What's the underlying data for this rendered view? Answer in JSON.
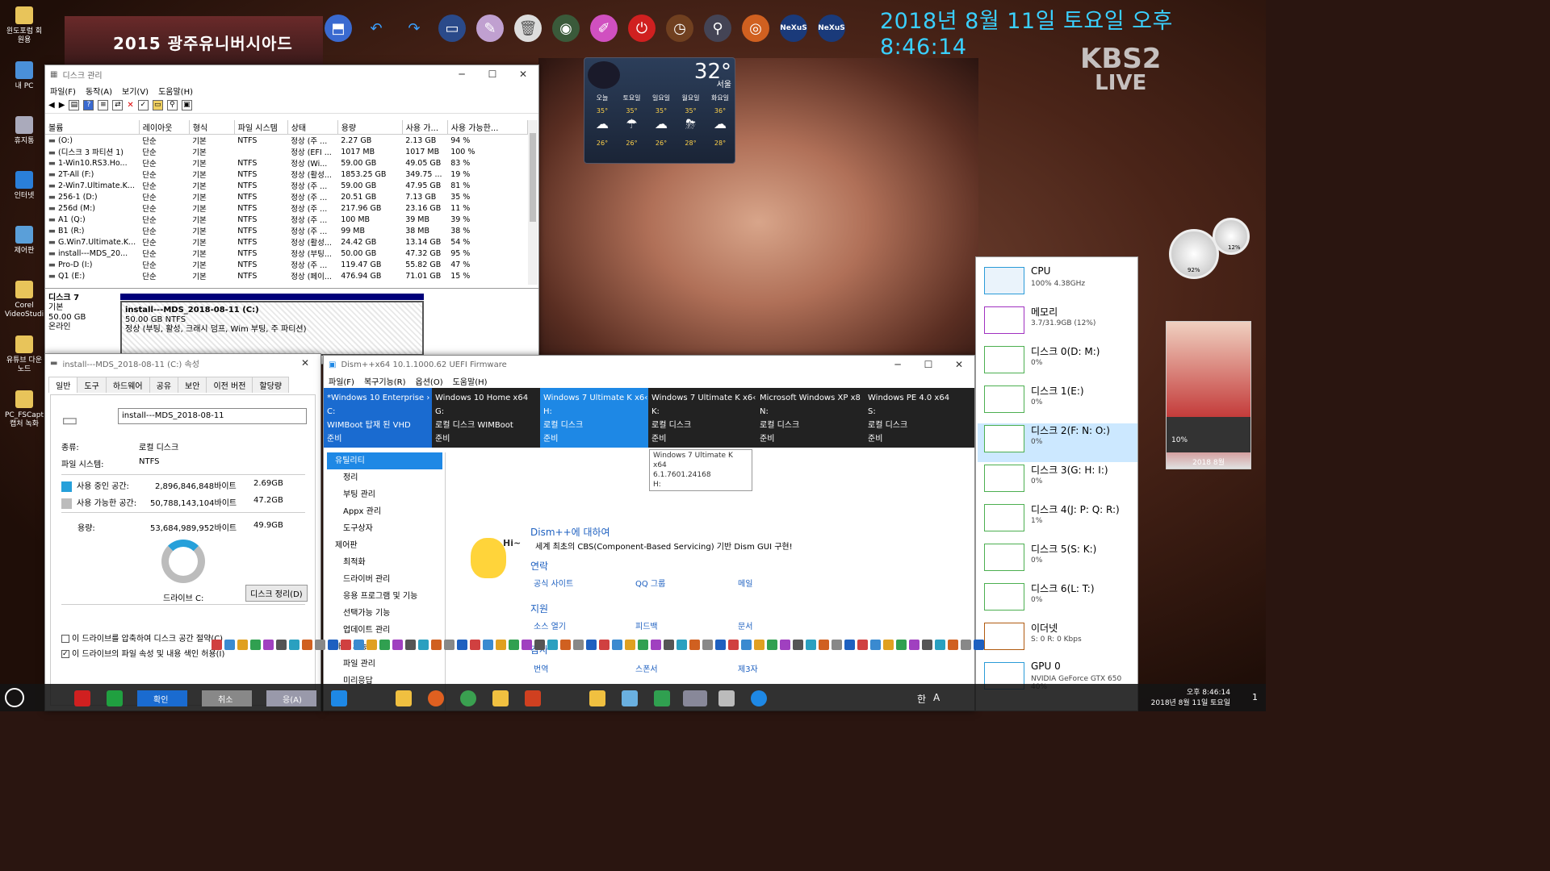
{
  "desktop": {
    "clock": "2018년 8월 11일 토요일 오후 8:46:14",
    "banner": "2015 광주유니버시아드",
    "channel": "KBS2",
    "channel_sub": "LIVE",
    "icons": [
      {
        "label": "윈도포럼 회원용",
        "color": "#e8c45a"
      },
      {
        "label": "내 PC",
        "color": "#4a90d9"
      },
      {
        "label": "휴지통",
        "color": "#aab"
      },
      {
        "label": "인터넷",
        "color": "#2a7fd9"
      },
      {
        "label": "제어판",
        "color": "#5a9fd9"
      },
      {
        "label": "Corel VideoStudi",
        "color": "#e8c45a"
      },
      {
        "label": "유튜브 다운노드",
        "color": "#e8c45a"
      },
      {
        "label": "PC_FSCapt 캡처 녹화",
        "color": "#e8c45a"
      }
    ],
    "toolbar_icons": [
      "usb-icon",
      "undo-icon",
      "redo-icon",
      "monitor-icon",
      "brush-icon",
      "trash-icon",
      "network-icon",
      "eraser-icon",
      "power-icon",
      "clock-icon",
      "search-icon",
      "media-icon",
      "nexus-icon",
      "nexus-icon"
    ],
    "toolbar_text": {
      "nexus1": "NeXuS",
      "nexus2": "NeXuS"
    }
  },
  "weather": {
    "temp": "32°",
    "city": "서울",
    "days": [
      {
        "name": "오늘",
        "hi": "35°",
        "lo": "26°",
        "icon": "☁"
      },
      {
        "name": "토요일",
        "hi": "35°",
        "lo": "26°",
        "icon": "☂"
      },
      {
        "name": "일요일",
        "hi": "35°",
        "lo": "26°",
        "icon": "☁"
      },
      {
        "name": "월요일",
        "hi": "35°",
        "lo": "28°",
        "icon": "⛈"
      },
      {
        "name": "화요일",
        "hi": "36°",
        "lo": "28°",
        "icon": "☁"
      }
    ]
  },
  "diskmgmt": {
    "title": "디스크 관리",
    "menu": [
      "파일(F)",
      "동작(A)",
      "보기(V)",
      "도움말(H)"
    ],
    "columns": [
      "볼륨",
      "레이아웃",
      "형식",
      "파일 시스템",
      "상태",
      "용량",
      "사용 가...",
      "사용 가능한..."
    ],
    "rows": [
      [
        "(O:)",
        "단순",
        "기본",
        "NTFS",
        "정상 (주 ...",
        "2.27 GB",
        "2.13 GB",
        "94 %"
      ],
      [
        "(디스크 3 파티션 1)",
        "단순",
        "기본",
        "",
        "정상 (EFI ...",
        "1017 MB",
        "1017 MB",
        "100 %"
      ],
      [
        "1-Win10.RS3.Ho...",
        "단순",
        "기본",
        "NTFS",
        "정상 (Wi...",
        "59.00 GB",
        "49.05 GB",
        "83 %"
      ],
      [
        "2T-All (F:)",
        "단순",
        "기본",
        "NTFS",
        "정상 (활성...",
        "1853.25 GB",
        "349.75 ...",
        "19 %"
      ],
      [
        "2-Win7.Ultimate.K...",
        "단순",
        "기본",
        "NTFS",
        "정상 (주 ...",
        "59.00 GB",
        "47.95 GB",
        "81 %"
      ],
      [
        "256-1 (D:)",
        "단순",
        "기본",
        "NTFS",
        "정상 (주 ...",
        "20.51 GB",
        "7.13 GB",
        "35 %"
      ],
      [
        "256d (M:)",
        "단순",
        "기본",
        "NTFS",
        "정상 (주 ...",
        "217.96 GB",
        "23.16 GB",
        "11 %"
      ],
      [
        "A1 (Q:)",
        "단순",
        "기본",
        "NTFS",
        "정상 (주 ...",
        "100 MB",
        "39 MB",
        "39 %"
      ],
      [
        "B1 (R:)",
        "단순",
        "기본",
        "NTFS",
        "정상 (주 ...",
        "99 MB",
        "38 MB",
        "38 %"
      ],
      [
        "G.Win7.Ultimate.K...",
        "단순",
        "기본",
        "NTFS",
        "정상 (활성...",
        "24.42 GB",
        "13.14 GB",
        "54 %"
      ],
      [
        "install---MDS_20...",
        "단순",
        "기본",
        "NTFS",
        "정상 (부팅...",
        "50.00 GB",
        "47.32 GB",
        "95 %"
      ],
      [
        "Pro-D (I:)",
        "단순",
        "기본",
        "NTFS",
        "정상 (주 ...",
        "119.47 GB",
        "55.82 GB",
        "47 %"
      ],
      [
        "Q1 (E:)",
        "단순",
        "기본",
        "NTFS",
        "정상 (페이...",
        "476.94 GB",
        "71.01 GB",
        "15 %"
      ]
    ],
    "disk7": {
      "name": "디스크 7",
      "type": "기본",
      "size": "50.00 GB",
      "state": "온라인",
      "part_name": "install---MDS_2018-08-11  (C:)",
      "part_size": "50.00 GB NTFS",
      "part_state": "정상 (부팅, 활성, 크래시 덤프, Wim 부팅, 주 파티션)"
    }
  },
  "props": {
    "title": "install---MDS_2018-08-11 (C:) 속성",
    "tabs": [
      "일반",
      "도구",
      "하드웨어",
      "공유",
      "보안",
      "이전 버전",
      "할당량"
    ],
    "name_value": "install---MDS_2018-08-11",
    "type_label": "종류:",
    "type_value": "로컬 디스크",
    "fs_label": "파일 시스템:",
    "fs_value": "NTFS",
    "used_label": "사용 중인 공간:",
    "used_bytes": "2,896,846,848바이트",
    "used_gb": "2.69GB",
    "free_label": "사용 가능한 공간:",
    "free_bytes": "50,788,143,104바이트",
    "free_gb": "47.2GB",
    "cap_label": "용량:",
    "cap_bytes": "53,684,989,952바이트",
    "cap_gb": "49.9GB",
    "drive_label": "드라이브 C:",
    "cleanup": "디스크 정리(D)",
    "compress": "이 드라이브를 압축하여 디스크 공간 절약(C)",
    "index": "이 드라이브의 파일 속성 및 내용 색인 허용(I)"
  },
  "dism": {
    "title": "Dism++x64 10.1.1000.62 UEFI Firmware",
    "menu": [
      "파일(F)",
      "복구기능(R)",
      "옵션(O)",
      "도움말(H)"
    ],
    "tabs": [
      {
        "l1": "*Windows 10 Enterprise ›",
        "l2": "C:",
        "l3": "WIMBoot 탑재 된 VHD",
        "l4": "준비"
      },
      {
        "l1": "Windows 10 Home x64",
        "l2": "G:",
        "l3": "로컬 디스크 WIMBoot",
        "l4": "준비"
      },
      {
        "l1": "Windows 7 Ultimate K x6‹",
        "l2": "H:",
        "l3": "로컬 디스크",
        "l4": "준비"
      },
      {
        "l1": "Windows 7 Ultimate K x6‹",
        "l2": "K:",
        "l3": "로컬 디스크",
        "l4": "준비"
      },
      {
        "l1": "Microsoft Windows XP x8",
        "l2": "N:",
        "l3": "로컬 디스크",
        "l4": "준비"
      },
      {
        "l1": "Windows PE 4.0 x64",
        "l2": "S:",
        "l3": "로컬 디스크",
        "l4": "준비"
      }
    ],
    "tooltip": [
      "Windows 7 Ultimate K x64",
      "6.1.7601.24168",
      "H:"
    ],
    "side": [
      {
        "t": "h",
        "v": "유틸리티"
      },
      {
        "t": "it",
        "v": "정리"
      },
      {
        "t": "it",
        "v": "부팅 관리"
      },
      {
        "t": "it",
        "v": "Appx 관리"
      },
      {
        "t": "it",
        "v": "도구상자"
      },
      {
        "t": "hd",
        "v": "제어판"
      },
      {
        "t": "it",
        "v": "최적화"
      },
      {
        "t": "it",
        "v": "드라이버 관리"
      },
      {
        "t": "it",
        "v": "응용 프로그램 및 기능"
      },
      {
        "t": "it",
        "v": "선택가능 기능"
      },
      {
        "t": "it",
        "v": "업데이트 관리"
      },
      {
        "t": "hd",
        "v": "배치 기능"
      },
      {
        "t": "it",
        "v": "파일 관리"
      },
      {
        "t": "it",
        "v": "미리응답"
      }
    ],
    "about_title": "Dism++에 대하여",
    "about_desc": "세계 최초의 CBS(Component-Based Servicing) 기반 Dism GUI 구현!",
    "hi": "Hi~",
    "contact": "연락",
    "contact_links": [
      "공식 사이트",
      "QQ 그룹",
      "메일"
    ],
    "support": "지원",
    "support_links": [
      "소스 열기",
      "피드백",
      "문서"
    ],
    "thanks": "감사",
    "thanks_links": [
      "번역",
      "스폰서",
      "제3자"
    ]
  },
  "perf": {
    "items": [
      {
        "name": "CPU",
        "value": "100% 4.38GHz",
        "color": "#2a9bd8"
      },
      {
        "name": "메모리",
        "value": "3.7/31.9GB (12%)",
        "color": "#a030c0"
      },
      {
        "name": "디스크 0(D: M:)",
        "value": "0%",
        "color": "#4caf50"
      },
      {
        "name": "디스크 1(E:)",
        "value": "0%",
        "color": "#4caf50"
      },
      {
        "name": "디스크 2(F: N: O:)",
        "value": "0%",
        "color": "#4caf50"
      },
      {
        "name": "디스크 3(G: H: I:)",
        "value": "0%",
        "color": "#4caf50"
      },
      {
        "name": "디스크 4(J: P: Q: R:)",
        "value": "1%",
        "color": "#4caf50"
      },
      {
        "name": "디스크 5(S: K:)",
        "value": "0%",
        "color": "#4caf50"
      },
      {
        "name": "디스크 6(L: T:)",
        "value": "0%",
        "color": "#4caf50"
      },
      {
        "name": "이더넷",
        "value": "S: 0 R: 0 Kbps",
        "color": "#b05a10"
      },
      {
        "name": "GPU 0",
        "value": "NVIDIA GeForce GTX 650\n40%",
        "color": "#2a9bd8"
      }
    ]
  },
  "widgets": {
    "gauge1": "92%",
    "gauge2": "12%",
    "cal_date": "2018 8월",
    "vol": "10%"
  },
  "taskbar": {
    "time": "오후 8:46:14",
    "date": "2018년 8월 11일 토요일",
    "ime": "한",
    "ime2": "A",
    "btn1": "확인",
    "btn2": "취소",
    "btn3": "응(A)",
    "notif": "1"
  }
}
